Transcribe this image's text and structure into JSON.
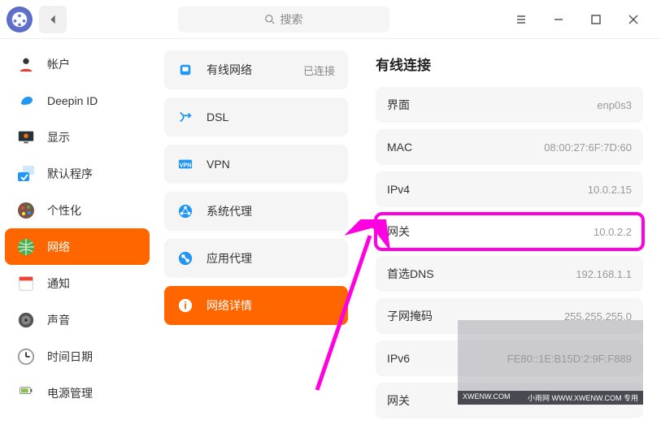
{
  "titlebar": {
    "search_placeholder": "搜索"
  },
  "sidebar": [
    {
      "label": "帐户",
      "id": "account"
    },
    {
      "label": "Deepin ID",
      "id": "deepin-id"
    },
    {
      "label": "显示",
      "id": "display"
    },
    {
      "label": "默认程序",
      "id": "default-apps"
    },
    {
      "label": "个性化",
      "id": "personalization"
    },
    {
      "label": "网络",
      "id": "network",
      "active": true
    },
    {
      "label": "通知",
      "id": "notification"
    },
    {
      "label": "声音",
      "id": "sound"
    },
    {
      "label": "时间日期",
      "id": "datetime"
    },
    {
      "label": "电源管理",
      "id": "power"
    }
  ],
  "mid": [
    {
      "label": "有线网络",
      "id": "wired",
      "status": "已连接"
    },
    {
      "label": "DSL",
      "id": "dsl"
    },
    {
      "label": "VPN",
      "id": "vpn"
    },
    {
      "label": "系统代理",
      "id": "sys-proxy"
    },
    {
      "label": "应用代理",
      "id": "app-proxy"
    },
    {
      "label": "网络详情",
      "id": "net-details",
      "active": true
    }
  ],
  "right": {
    "title": "有线连接",
    "rows": [
      {
        "key": "界面",
        "val": "enp0s3"
      },
      {
        "key": "MAC",
        "val": "08:00:27:6F:7D:60"
      },
      {
        "key": "IPv4",
        "val": "10.0.2.15"
      },
      {
        "key": "网关",
        "val": "10.0.2.2",
        "highlight": true
      },
      {
        "key": "首选DNS",
        "val": "192.168.1.1"
      },
      {
        "key": "子网掩码",
        "val": "255.255.255.0"
      },
      {
        "key": "IPv6",
        "val": "FE80::1E:B15D:2:9F:F889"
      },
      {
        "key": "网关",
        "val": ""
      }
    ]
  },
  "watermark": {
    "left": "XWENW.COM",
    "right": "小雨网 WWW.XWENW.COM 专用"
  }
}
